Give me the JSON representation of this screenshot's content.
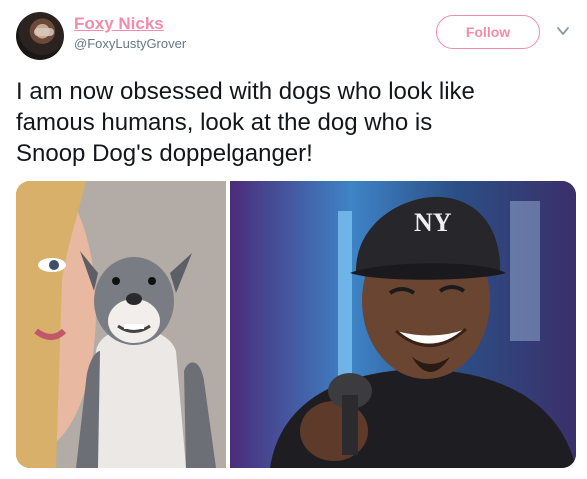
{
  "user": {
    "display_name": "Foxy Nicks",
    "handle": "@FoxyLustyGrover",
    "avatar_icon": "profile-photo"
  },
  "actions": {
    "follow_label": "Follow",
    "menu_icon": "chevron-down-icon"
  },
  "tweet": {
    "text": "I am now obsessed with dogs who look like\nfamous humans, look at the dog who is\nSnoop Dog's doppelganger!"
  },
  "media": {
    "images": [
      {
        "name": "dog-photo"
      },
      {
        "name": "snoop-dogg-photo"
      }
    ]
  },
  "colors": {
    "accent": "#f28ca9",
    "secondary_text": "#657786",
    "primary_text": "#14171a"
  }
}
